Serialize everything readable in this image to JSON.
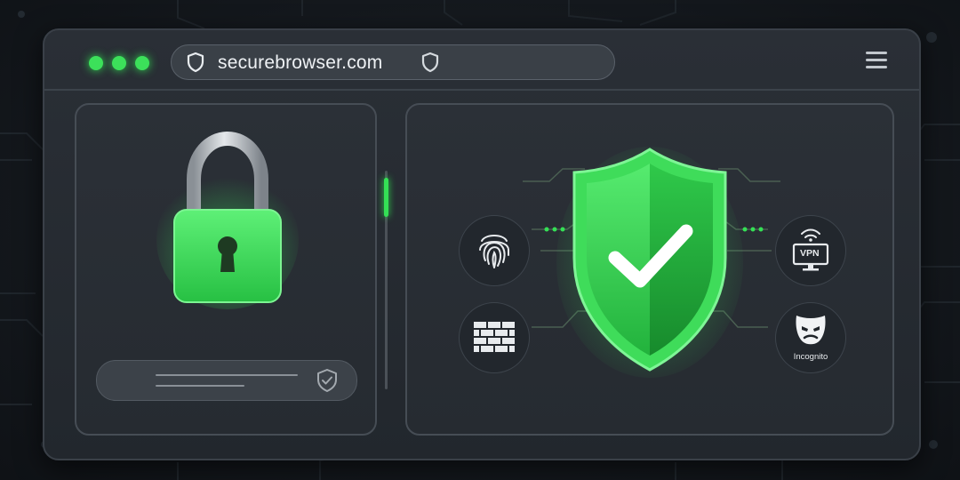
{
  "browser": {
    "url": "securebrowser.com",
    "window_controls": [
      "dot",
      "dot",
      "dot"
    ],
    "menu_icon": "hamburger-menu-icon"
  },
  "lock_panel": {
    "icon": "padlock-icon",
    "field_icon": "shield-check-icon"
  },
  "security_panel": {
    "center_icon": "shield-check-icon",
    "features": [
      {
        "name": "fingerprint",
        "icon": "fingerprint-icon",
        "label": ""
      },
      {
        "name": "firewall",
        "icon": "brick-wall-icon",
        "label": ""
      },
      {
        "name": "vpn",
        "icon": "vpn-monitor-icon",
        "label": "VPN"
      },
      {
        "name": "incognito",
        "icon": "incognito-mask-icon",
        "label": "Incognito"
      }
    ]
  },
  "colors": {
    "accent": "#34e055",
    "background": "#14181d",
    "panel": "#2b3037"
  }
}
